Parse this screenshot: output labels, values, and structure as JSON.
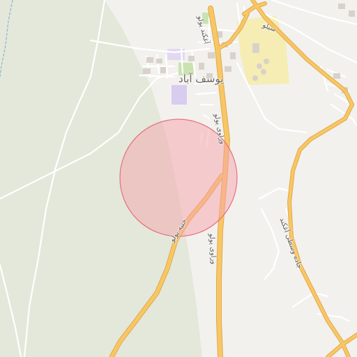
{
  "map": {
    "place_labels": {
      "town": "یوسف آباد"
    },
    "road_labels": {
      "main_north": "وراوی یولو",
      "main_south": "وراوی یولو",
      "side_southwest": "ختیه یولو",
      "east_road": "جاده وسطی آغکند",
      "north_street_1": "سیلو",
      "north_street_2": "آغکند یولو"
    },
    "marker": {
      "type": "location-accuracy-circle",
      "fill": "#f5a3ab",
      "stroke": "#e8707c"
    },
    "colors": {
      "land": "#f3f1ee",
      "vegetation": "#e3e8da",
      "major_road": "#f8c765",
      "major_road_casing": "#e0a94a",
      "minor_road": "#ffffff",
      "building": "#d8d2ca",
      "park": "#c9e3b0",
      "school": "#d8ccef",
      "industrial": "#f6edb4",
      "water_line": "#8fb1d6"
    }
  }
}
